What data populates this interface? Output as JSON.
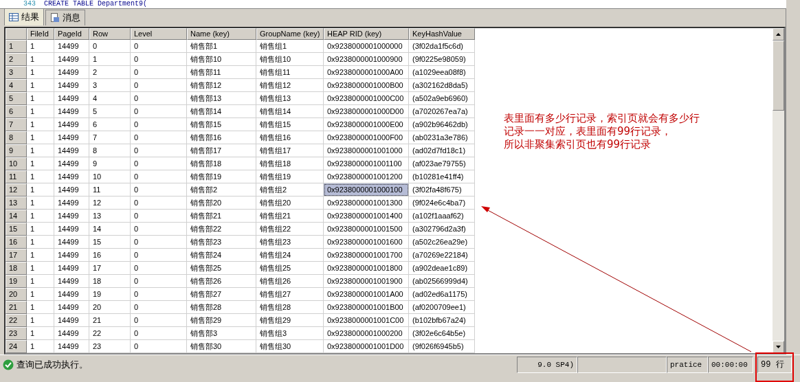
{
  "editor": {
    "line_number": "343",
    "code": "CREATE TABLE Department9("
  },
  "tabs": [
    {
      "label": "结果",
      "selected": true
    },
    {
      "label": "消息",
      "selected": false
    }
  ],
  "table": {
    "columns": [
      "FileId",
      "PageId",
      "Row",
      "Level",
      "Name (key)",
      "GroupName (key)",
      "HEAP RID (key)",
      "KeyHashValue"
    ],
    "rows": [
      {
        "num": "1",
        "cells": [
          "1",
          "14499",
          "0",
          "0",
          "销售部1",
          "销售组1",
          "0x9238000001000000",
          "(3f02da1f5c6d)"
        ],
        "selected": false
      },
      {
        "num": "2",
        "cells": [
          "1",
          "14499",
          "1",
          "0",
          "销售部10",
          "销售组10",
          "0x9238000001000900",
          "(9f0225e98059)"
        ],
        "selected": false
      },
      {
        "num": "3",
        "cells": [
          "1",
          "14499",
          "2",
          "0",
          "销售部11",
          "销售组11",
          "0x9238000001000A00",
          "(a1029eea08f8)"
        ],
        "selected": false
      },
      {
        "num": "4",
        "cells": [
          "1",
          "14499",
          "3",
          "0",
          "销售部12",
          "销售组12",
          "0x9238000001000B00",
          "(a302162d8da5)"
        ],
        "selected": false
      },
      {
        "num": "5",
        "cells": [
          "1",
          "14499",
          "4",
          "0",
          "销售部13",
          "销售组13",
          "0x9238000001000C00",
          "(a502a9eb6960)"
        ],
        "selected": false
      },
      {
        "num": "6",
        "cells": [
          "1",
          "14499",
          "5",
          "0",
          "销售部14",
          "销售组14",
          "0x9238000001000D00",
          "(a7020267ea7a)"
        ],
        "selected": false
      },
      {
        "num": "7",
        "cells": [
          "1",
          "14499",
          "6",
          "0",
          "销售部15",
          "销售组15",
          "0x9238000001000E00",
          "(a902b96462db)"
        ],
        "selected": false
      },
      {
        "num": "8",
        "cells": [
          "1",
          "14499",
          "7",
          "0",
          "销售部16",
          "销售组16",
          "0x9238000001000F00",
          "(ab0231a3e786)"
        ],
        "selected": false
      },
      {
        "num": "9",
        "cells": [
          "1",
          "14499",
          "8",
          "0",
          "销售部17",
          "销售组17",
          "0x9238000001001000",
          "(ad02d7fd18c1)"
        ],
        "selected": false
      },
      {
        "num": "10",
        "cells": [
          "1",
          "14499",
          "9",
          "0",
          "销售部18",
          "销售组18",
          "0x9238000001001100",
          "(af023ae79755)"
        ],
        "selected": false
      },
      {
        "num": "11",
        "cells": [
          "1",
          "14499",
          "10",
          "0",
          "销售部19",
          "销售组19",
          "0x9238000001001200",
          "(b10281e41ff4)"
        ],
        "selected": false
      },
      {
        "num": "12",
        "cells": [
          "1",
          "14499",
          "11",
          "0",
          "销售部2",
          "销售组2",
          "0x9238000001000100",
          "(3f02fa48f675)"
        ],
        "selected": true
      },
      {
        "num": "13",
        "cells": [
          "1",
          "14499",
          "12",
          "0",
          "销售部20",
          "销售组20",
          "0x9238000001001300",
          "(9f024e6c4ba7)"
        ],
        "selected": false
      },
      {
        "num": "14",
        "cells": [
          "1",
          "14499",
          "13",
          "0",
          "销售部21",
          "销售组21",
          "0x9238000001001400",
          "(a102f1aaaf62)"
        ],
        "selected": false
      },
      {
        "num": "15",
        "cells": [
          "1",
          "14499",
          "14",
          "0",
          "销售部22",
          "销售组22",
          "0x9238000001001500",
          "(a302796d2a3f)"
        ],
        "selected": false
      },
      {
        "num": "16",
        "cells": [
          "1",
          "14499",
          "15",
          "0",
          "销售部23",
          "销售组23",
          "0x9238000001001600",
          "(a502c26ea29e)"
        ],
        "selected": false
      },
      {
        "num": "17",
        "cells": [
          "1",
          "14499",
          "16",
          "0",
          "销售部24",
          "销售组24",
          "0x9238000001001700",
          "(a70269e22184)"
        ],
        "selected": false
      },
      {
        "num": "18",
        "cells": [
          "1",
          "14499",
          "17",
          "0",
          "销售部25",
          "销售组25",
          "0x9238000001001800",
          "(a902deae1c89)"
        ],
        "selected": false
      },
      {
        "num": "19",
        "cells": [
          "1",
          "14499",
          "18",
          "0",
          "销售部26",
          "销售组26",
          "0x9238000001001900",
          "(ab02566999d4)"
        ],
        "selected": false
      },
      {
        "num": "20",
        "cells": [
          "1",
          "14499",
          "19",
          "0",
          "销售部27",
          "销售组27",
          "0x9238000001001A00",
          "(ad02ed6a1175)"
        ],
        "selected": false
      },
      {
        "num": "21",
        "cells": [
          "1",
          "14499",
          "20",
          "0",
          "销售部28",
          "销售组28",
          "0x9238000001001B00",
          "(af0200709ee1)"
        ],
        "selected": false
      },
      {
        "num": "22",
        "cells": [
          "1",
          "14499",
          "21",
          "0",
          "销售部29",
          "销售组29",
          "0x9238000001001C00",
          "(b102bfb67a24)"
        ],
        "selected": false
      },
      {
        "num": "23",
        "cells": [
          "1",
          "14499",
          "22",
          "0",
          "销售部3",
          "销售组3",
          "0x9238000001000200",
          "(3f02e6c64b5e)"
        ],
        "selected": false
      },
      {
        "num": "24",
        "cells": [
          "1",
          "14499",
          "23",
          "0",
          "销售部30",
          "销售组30",
          "0x9238000001001D00",
          "(9f026f6945b5)"
        ],
        "selected": false
      }
    ]
  },
  "annotation": {
    "lines": [
      "表里面有多少行记录，索引页就会有多少行",
      "记录一一对应，表里面有99行记录，",
      "所以非聚集索引页也有99行记录"
    ]
  },
  "status_bar": {
    "message": "查询已成功执行。",
    "server_version": "9.0 SP4)",
    "database": "pratice",
    "elapsed": "00:00:00",
    "row_count": "99 行"
  }
}
